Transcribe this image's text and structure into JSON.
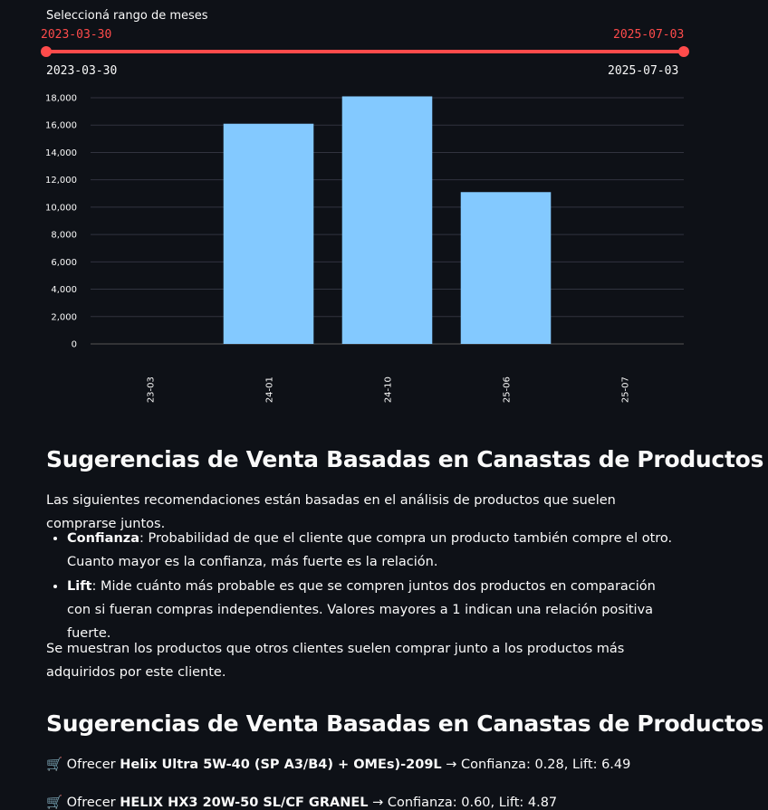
{
  "slider": {
    "label": "Seleccioná rango de meses",
    "start_value": "2023-03-30",
    "end_value": "2025-07-03",
    "range_min": "2023-03-30",
    "range_max": "2025-07-03",
    "accent": "#ff4b4b"
  },
  "chart_data": {
    "type": "bar",
    "categories": [
      "2023-03",
      "2024-01",
      "2024-10",
      "2025-06",
      "2025-07"
    ],
    "values": [
      0,
      16100,
      18100,
      11100,
      0
    ],
    "ylim": [
      0,
      18000
    ],
    "yticks": [
      "0",
      "2,000",
      "4,000",
      "6,000",
      "8,000",
      "10,000",
      "12,000",
      "14,000",
      "16,000",
      "18,000"
    ],
    "grid": true,
    "bar_color": "#83c9ff"
  },
  "section1": {
    "title": "Sugerencias de Venta Basadas en Canastas de Productos",
    "intro": "Las siguientes recomendaciones están basadas en el análisis de productos que suelen comprarse juntos.",
    "bullets": [
      {
        "term": "Confianza",
        "text": ": Probabilidad de que el cliente que compra un producto también compre el otro. Cuanto mayor es la confianza, más fuerte es la relación."
      },
      {
        "term": "Lift",
        "text": ": Mide cuánto más probable es que se compren juntos dos productos en comparación con si fueran compras independientes. Valores mayores a 1 indican una relación positiva fuerte."
      }
    ],
    "closing": "Se muestran los productos que otros clientes suelen comprar junto a los productos más adquiridos por este cliente."
  },
  "section2": {
    "title": "Sugerencias de Venta Basadas en Canastas de Productos",
    "suggestions": [
      {
        "icon": "🛒",
        "prefix": "Ofrecer ",
        "product": "Helix Ultra 5W-40 (SP A3/B4) + OMEs)-209L",
        "stats": " → Confianza: 0.28, Lift: 6.49"
      },
      {
        "icon": "🛒",
        "prefix": "Ofrecer ",
        "product": "HELIX HX3 20W-50 SL/CF GRANEL",
        "stats": " → Confianza: 0.60, Lift: 4.87"
      }
    ]
  }
}
